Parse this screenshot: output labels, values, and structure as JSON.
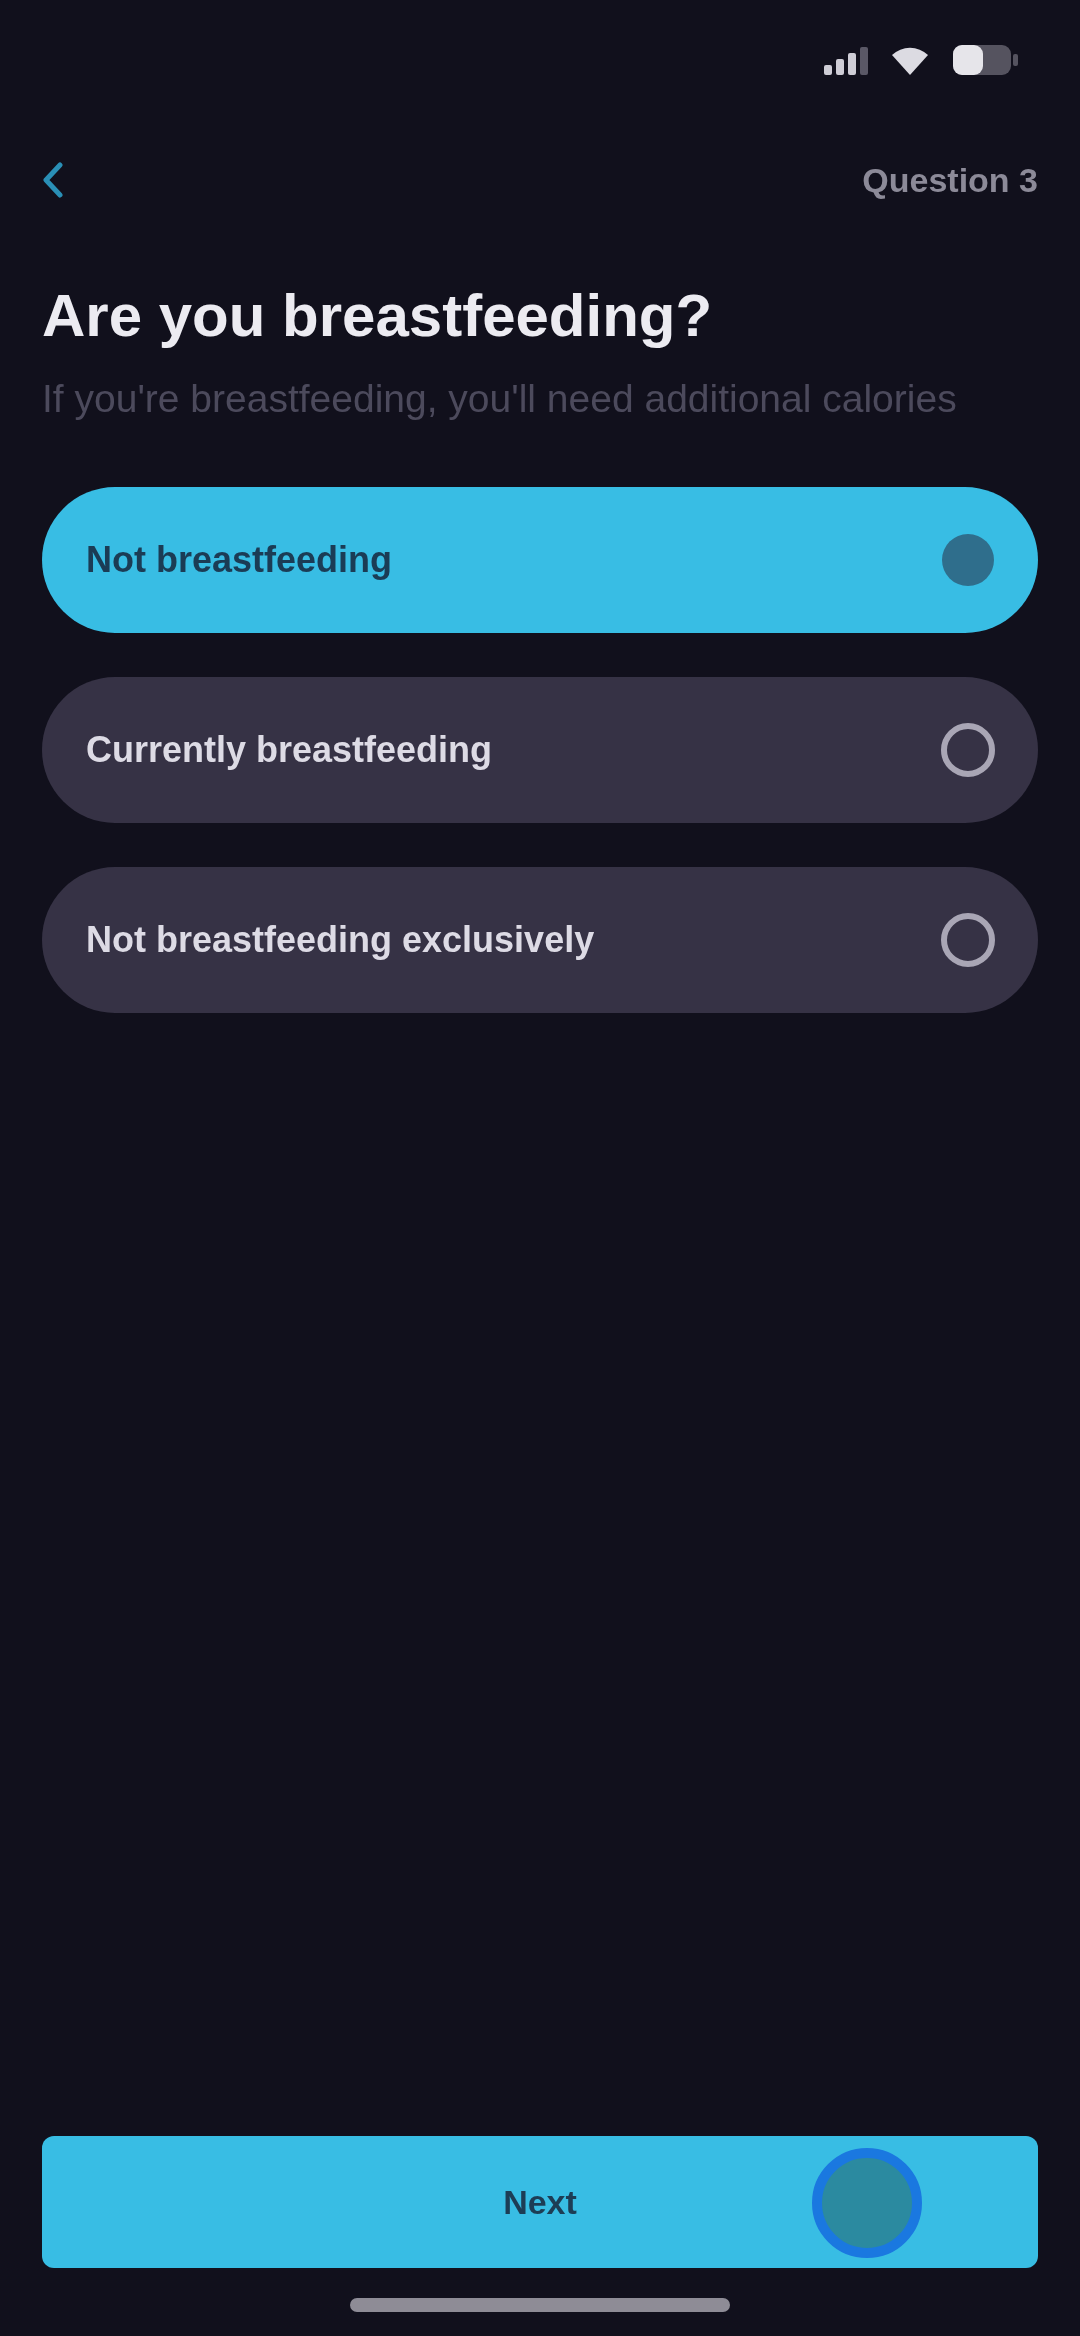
{
  "nav": {
    "step_label": "Question 3"
  },
  "question": {
    "title": "Are you breastfeeding?",
    "subtitle": "If you're breastfeeding, you'll need additional calories"
  },
  "options": [
    {
      "label": "Not breastfeeding",
      "selected": true
    },
    {
      "label": "Currently breastfeeding",
      "selected": false
    },
    {
      "label": "Not breastfeeding exclusively",
      "selected": false
    }
  ],
  "next_button": {
    "label": "Next"
  }
}
